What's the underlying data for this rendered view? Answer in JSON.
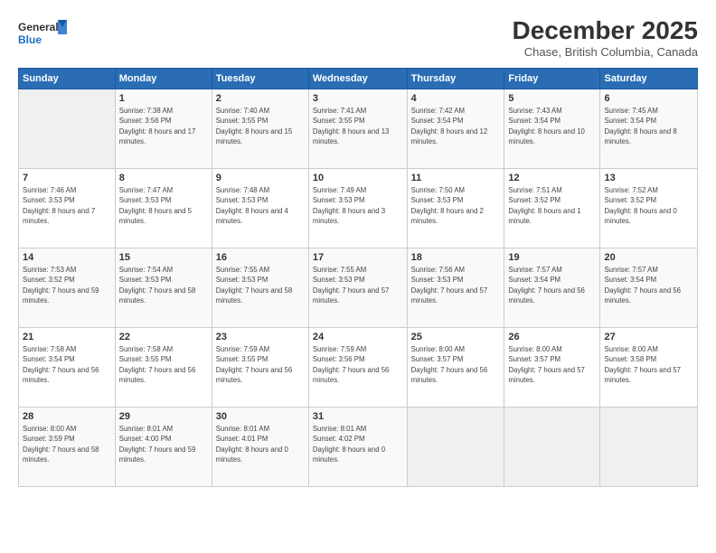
{
  "header": {
    "logo_line1": "General",
    "logo_line2": "Blue",
    "month": "December 2025",
    "location": "Chase, British Columbia, Canada"
  },
  "days_of_week": [
    "Sunday",
    "Monday",
    "Tuesday",
    "Wednesday",
    "Thursday",
    "Friday",
    "Saturday"
  ],
  "weeks": [
    [
      {
        "day": "",
        "sunrise": "",
        "sunset": "",
        "daylight": ""
      },
      {
        "day": "1",
        "sunrise": "Sunrise: 7:38 AM",
        "sunset": "Sunset: 3:56 PM",
        "daylight": "Daylight: 8 hours and 17 minutes."
      },
      {
        "day": "2",
        "sunrise": "Sunrise: 7:40 AM",
        "sunset": "Sunset: 3:55 PM",
        "daylight": "Daylight: 8 hours and 15 minutes."
      },
      {
        "day": "3",
        "sunrise": "Sunrise: 7:41 AM",
        "sunset": "Sunset: 3:55 PM",
        "daylight": "Daylight: 8 hours and 13 minutes."
      },
      {
        "day": "4",
        "sunrise": "Sunrise: 7:42 AM",
        "sunset": "Sunset: 3:54 PM",
        "daylight": "Daylight: 8 hours and 12 minutes."
      },
      {
        "day": "5",
        "sunrise": "Sunrise: 7:43 AM",
        "sunset": "Sunset: 3:54 PM",
        "daylight": "Daylight: 8 hours and 10 minutes."
      },
      {
        "day": "6",
        "sunrise": "Sunrise: 7:45 AM",
        "sunset": "Sunset: 3:54 PM",
        "daylight": "Daylight: 8 hours and 8 minutes."
      }
    ],
    [
      {
        "day": "7",
        "sunrise": "Sunrise: 7:46 AM",
        "sunset": "Sunset: 3:53 PM",
        "daylight": "Daylight: 8 hours and 7 minutes."
      },
      {
        "day": "8",
        "sunrise": "Sunrise: 7:47 AM",
        "sunset": "Sunset: 3:53 PM",
        "daylight": "Daylight: 8 hours and 5 minutes."
      },
      {
        "day": "9",
        "sunrise": "Sunrise: 7:48 AM",
        "sunset": "Sunset: 3:53 PM",
        "daylight": "Daylight: 8 hours and 4 minutes."
      },
      {
        "day": "10",
        "sunrise": "Sunrise: 7:49 AM",
        "sunset": "Sunset: 3:53 PM",
        "daylight": "Daylight: 8 hours and 3 minutes."
      },
      {
        "day": "11",
        "sunrise": "Sunrise: 7:50 AM",
        "sunset": "Sunset: 3:53 PM",
        "daylight": "Daylight: 8 hours and 2 minutes."
      },
      {
        "day": "12",
        "sunrise": "Sunrise: 7:51 AM",
        "sunset": "Sunset: 3:52 PM",
        "daylight": "Daylight: 8 hours and 1 minute."
      },
      {
        "day": "13",
        "sunrise": "Sunrise: 7:52 AM",
        "sunset": "Sunset: 3:52 PM",
        "daylight": "Daylight: 8 hours and 0 minutes."
      }
    ],
    [
      {
        "day": "14",
        "sunrise": "Sunrise: 7:53 AM",
        "sunset": "Sunset: 3:52 PM",
        "daylight": "Daylight: 7 hours and 59 minutes."
      },
      {
        "day": "15",
        "sunrise": "Sunrise: 7:54 AM",
        "sunset": "Sunset: 3:53 PM",
        "daylight": "Daylight: 7 hours and 58 minutes."
      },
      {
        "day": "16",
        "sunrise": "Sunrise: 7:55 AM",
        "sunset": "Sunset: 3:53 PM",
        "daylight": "Daylight: 7 hours and 58 minutes."
      },
      {
        "day": "17",
        "sunrise": "Sunrise: 7:55 AM",
        "sunset": "Sunset: 3:53 PM",
        "daylight": "Daylight: 7 hours and 57 minutes."
      },
      {
        "day": "18",
        "sunrise": "Sunrise: 7:56 AM",
        "sunset": "Sunset: 3:53 PM",
        "daylight": "Daylight: 7 hours and 57 minutes."
      },
      {
        "day": "19",
        "sunrise": "Sunrise: 7:57 AM",
        "sunset": "Sunset: 3:54 PM",
        "daylight": "Daylight: 7 hours and 56 minutes."
      },
      {
        "day": "20",
        "sunrise": "Sunrise: 7:57 AM",
        "sunset": "Sunset: 3:54 PM",
        "daylight": "Daylight: 7 hours and 56 minutes."
      }
    ],
    [
      {
        "day": "21",
        "sunrise": "Sunrise: 7:58 AM",
        "sunset": "Sunset: 3:54 PM",
        "daylight": "Daylight: 7 hours and 56 minutes."
      },
      {
        "day": "22",
        "sunrise": "Sunrise: 7:58 AM",
        "sunset": "Sunset: 3:55 PM",
        "daylight": "Daylight: 7 hours and 56 minutes."
      },
      {
        "day": "23",
        "sunrise": "Sunrise: 7:59 AM",
        "sunset": "Sunset: 3:55 PM",
        "daylight": "Daylight: 7 hours and 56 minutes."
      },
      {
        "day": "24",
        "sunrise": "Sunrise: 7:59 AM",
        "sunset": "Sunset: 3:56 PM",
        "daylight": "Daylight: 7 hours and 56 minutes."
      },
      {
        "day": "25",
        "sunrise": "Sunrise: 8:00 AM",
        "sunset": "Sunset: 3:57 PM",
        "daylight": "Daylight: 7 hours and 56 minutes."
      },
      {
        "day": "26",
        "sunrise": "Sunrise: 8:00 AM",
        "sunset": "Sunset: 3:57 PM",
        "daylight": "Daylight: 7 hours and 57 minutes."
      },
      {
        "day": "27",
        "sunrise": "Sunrise: 8:00 AM",
        "sunset": "Sunset: 3:58 PM",
        "daylight": "Daylight: 7 hours and 57 minutes."
      }
    ],
    [
      {
        "day": "28",
        "sunrise": "Sunrise: 8:00 AM",
        "sunset": "Sunset: 3:59 PM",
        "daylight": "Daylight: 7 hours and 58 minutes."
      },
      {
        "day": "29",
        "sunrise": "Sunrise: 8:01 AM",
        "sunset": "Sunset: 4:00 PM",
        "daylight": "Daylight: 7 hours and 59 minutes."
      },
      {
        "day": "30",
        "sunrise": "Sunrise: 8:01 AM",
        "sunset": "Sunset: 4:01 PM",
        "daylight": "Daylight: 8 hours and 0 minutes."
      },
      {
        "day": "31",
        "sunrise": "Sunrise: 8:01 AM",
        "sunset": "Sunset: 4:02 PM",
        "daylight": "Daylight: 8 hours and 0 minutes."
      },
      {
        "day": "",
        "sunrise": "",
        "sunset": "",
        "daylight": ""
      },
      {
        "day": "",
        "sunrise": "",
        "sunset": "",
        "daylight": ""
      },
      {
        "day": "",
        "sunrise": "",
        "sunset": "",
        "daylight": ""
      }
    ]
  ]
}
